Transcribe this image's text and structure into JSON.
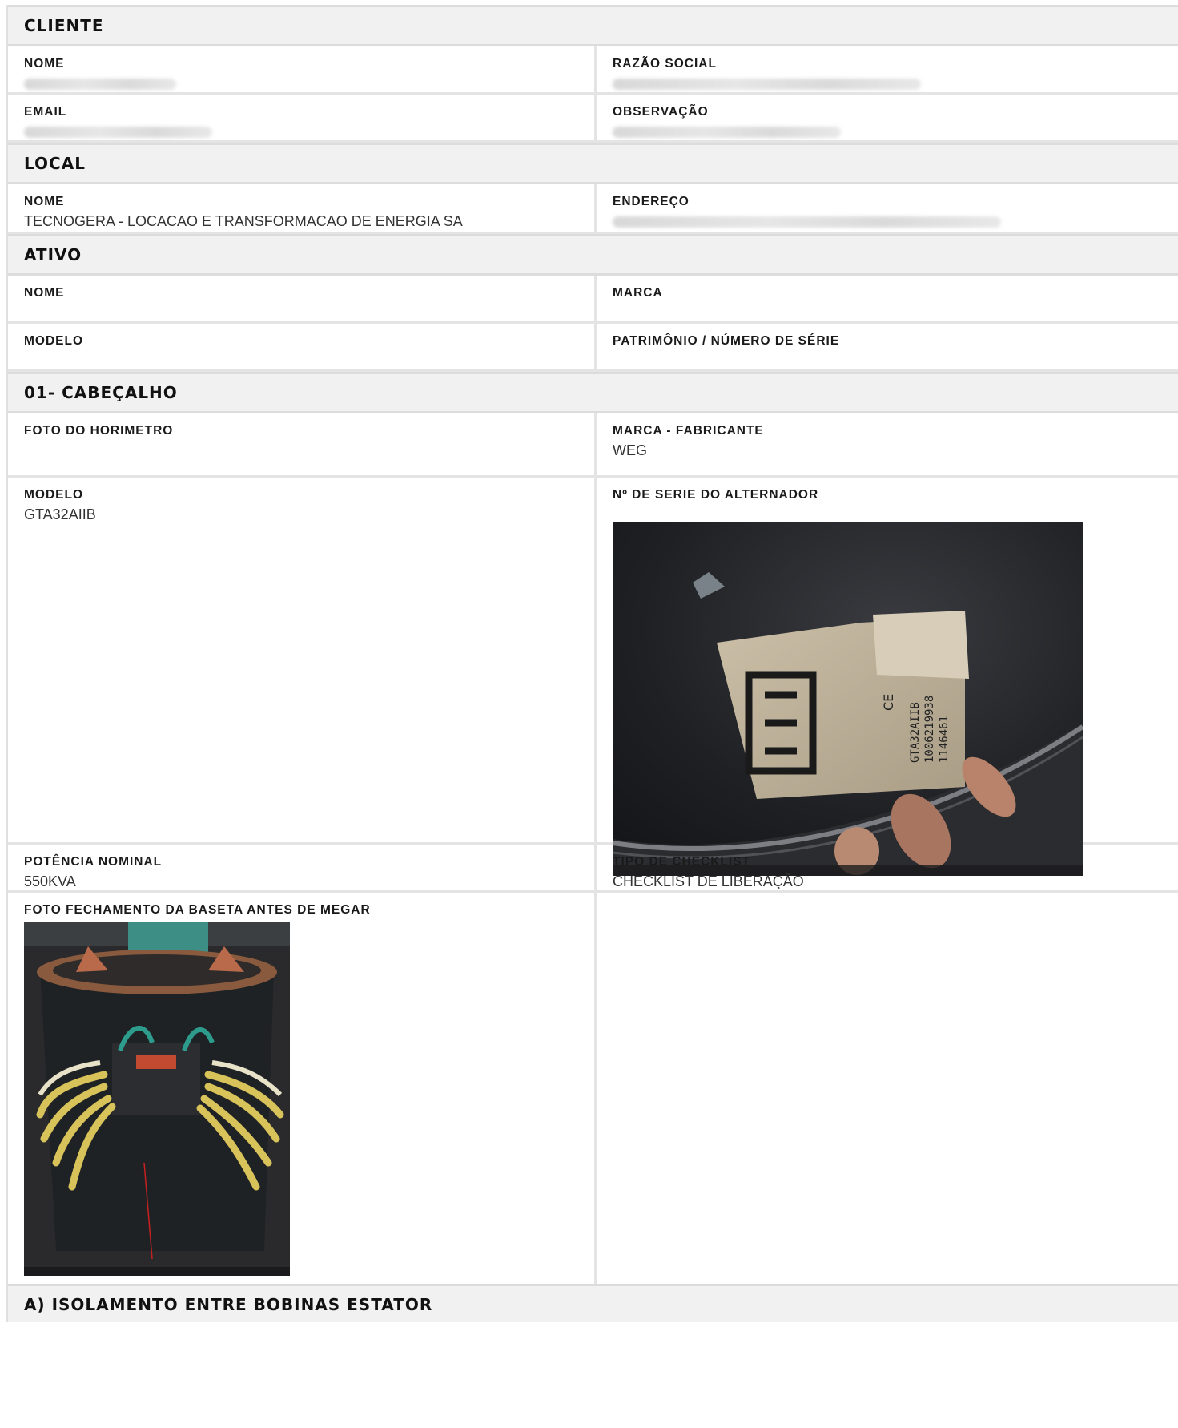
{
  "sections": {
    "cliente": {
      "title": "CLIENTE",
      "nome_label": "NOME",
      "razao_label": "RAZÃO SOCIAL",
      "email_label": "EMAIL",
      "obs_label": "OBSERVAÇÃO"
    },
    "local": {
      "title": "LOCAL",
      "nome_label": "NOME",
      "nome_value": "TECNOGERA - LOCACAO E TRANSFORMACAO DE ENERGIA SA",
      "endereco_label": "ENDEREÇO"
    },
    "ativo": {
      "title": "ATIVO",
      "nome_label": "NOME",
      "marca_label": "MARCA",
      "modelo_label": "MODELO",
      "patrimonio_label": "PATRIMÔNIO / NÚMERO DE SÉRIE"
    },
    "cabecalho": {
      "title": "01- CABEÇALHO",
      "foto_horimetro_label": "FOTO DO HORIMETRO",
      "marca_fabricante_label": "MARCA - FABRICANTE",
      "marca_fabricante_value": "WEG",
      "modelo_label": "MODELO",
      "modelo_value": "GTA32AIIB",
      "serie_label": "Nº DE SERIE DO ALTERNADOR",
      "potencia_label": "POTÊNCIA NOMINAL",
      "potencia_value": "550KVA",
      "tipo_checklist_label": "TIPO DE CHECKLIST",
      "tipo_checklist_value": "CHECKLIST DE LIBERAÇÃO",
      "foto_fechamento_label": "FOTO FECHAMENTO DA BASETA ANTES DE MEGAR"
    },
    "isolamento": {
      "title": "A) ISOLAMENTO ENTRE BOBINAS ESTATOR"
    }
  },
  "photos": {
    "serie_photo": {
      "subject": "WEG nameplate on alternator housing",
      "plate_text": [
        "GTA32AIIB",
        "1006219938",
        "1146461"
      ]
    },
    "fechamento_photo": {
      "subject": "alternator terminal box with yellow cables"
    }
  }
}
